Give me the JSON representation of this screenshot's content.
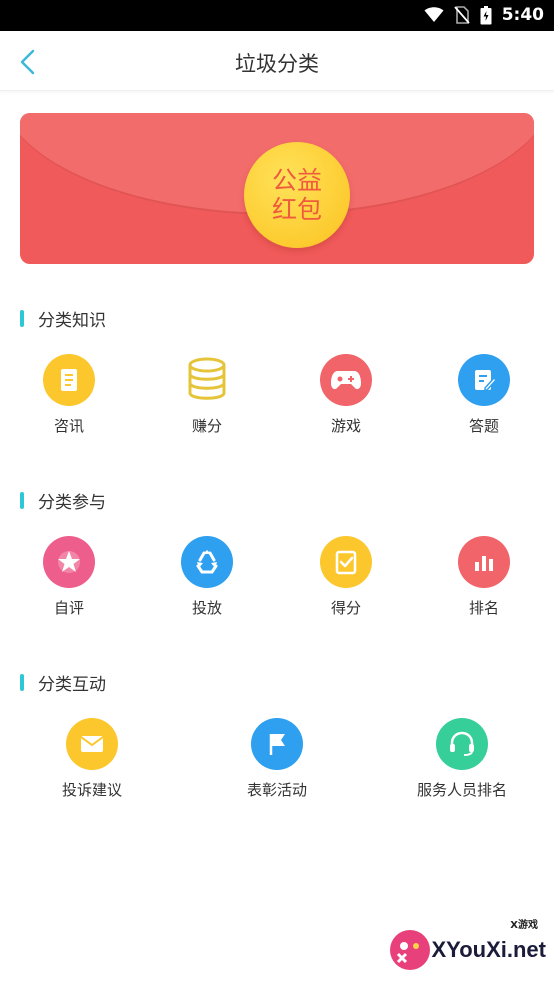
{
  "status_bar": {
    "time": "5:40"
  },
  "header": {
    "title": "垃圾分类"
  },
  "banner": {
    "text": "公益红包"
  },
  "sections": [
    {
      "title": "分类知识",
      "items": [
        {
          "label": "咨讯",
          "icon": "news-icon",
          "color": "#fcc72c"
        },
        {
          "label": "赚分",
          "icon": "coins-icon",
          "color": "#e5c43a"
        },
        {
          "label": "游戏",
          "icon": "gamepad-icon",
          "color": "#f0646a"
        },
        {
          "label": "答题",
          "icon": "edit-note-icon",
          "color": "#2f9ff0"
        }
      ]
    },
    {
      "title": "分类参与",
      "items": [
        {
          "label": "自评",
          "icon": "star-badge-icon",
          "color": "#ee5e8c"
        },
        {
          "label": "投放",
          "icon": "recycle-icon",
          "color": "#2f9ff0"
        },
        {
          "label": "得分",
          "icon": "score-check-icon",
          "color": "#fcc72c"
        },
        {
          "label": "排名",
          "icon": "bar-chart-icon",
          "color": "#f0646a"
        }
      ]
    },
    {
      "title": "分类互动",
      "items": [
        {
          "label": "投诉建议",
          "icon": "mail-icon",
          "color": "#fcc72c"
        },
        {
          "label": "表彰活动",
          "icon": "flag-icon",
          "color": "#2f9ff0"
        },
        {
          "label": "服务人员排名",
          "icon": "headset-icon",
          "color": "#36cf9a"
        }
      ]
    }
  ],
  "watermark": {
    "brand": "XYouXi.net",
    "tag": "X游戏"
  }
}
